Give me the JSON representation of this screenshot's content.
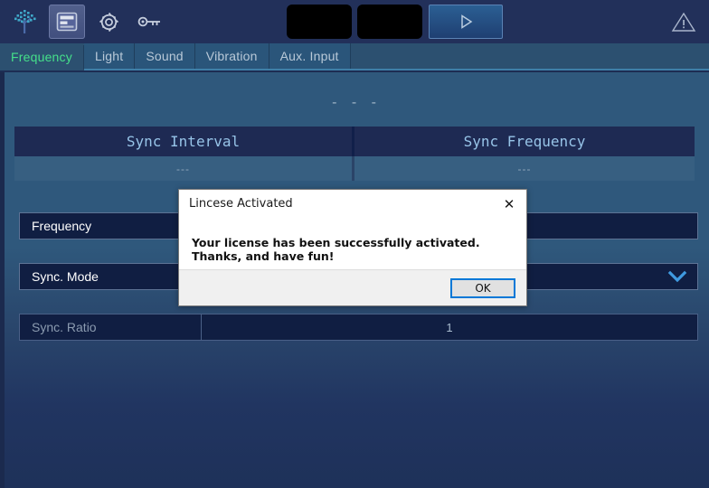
{
  "toolbar": {
    "icons": [
      {
        "name": "tree-logo-icon",
        "label": "Tree Logo"
      },
      {
        "name": "panel-layout-icon",
        "label": "Panel Layout"
      },
      {
        "name": "gear-icon",
        "label": "Settings"
      },
      {
        "name": "key-icon",
        "label": "License Key"
      }
    ],
    "display_1": "",
    "display_2": "",
    "play_label": "▷",
    "warning_label": "!"
  },
  "tabs": [
    {
      "label": "Frequency",
      "active": true
    },
    {
      "label": "Light",
      "active": false
    },
    {
      "label": "Sound",
      "active": false
    },
    {
      "label": "Vibration",
      "active": false
    },
    {
      "label": "Aux. Input",
      "active": false
    }
  ],
  "main": {
    "status_dashes": "- - -",
    "sync_table": {
      "headers": [
        "Sync Interval",
        "Sync Frequency"
      ],
      "values": [
        "---",
        "---"
      ]
    },
    "rows": [
      {
        "label": "Frequency",
        "value": "",
        "control": "text"
      },
      {
        "label": "Sync. Mode",
        "value": "",
        "control": "dropdown"
      },
      {
        "label": "Sync. Ratio",
        "value": "1",
        "control": "readonly"
      }
    ],
    "dropdown_glyph": "⌄"
  },
  "dialog": {
    "title": "Lincese Activated",
    "message": "Your license has been successfully activated. Thanks, and have fun!",
    "ok_label": "OK",
    "close_glyph": "✕"
  },
  "colors": {
    "accent_green": "#45e08a",
    "panel_blue": "#2f587c",
    "toolbar_blue": "#22305a",
    "field_navy": "#101e42",
    "focus_blue": "#0078d7",
    "header_navy": "#1e2a53"
  }
}
